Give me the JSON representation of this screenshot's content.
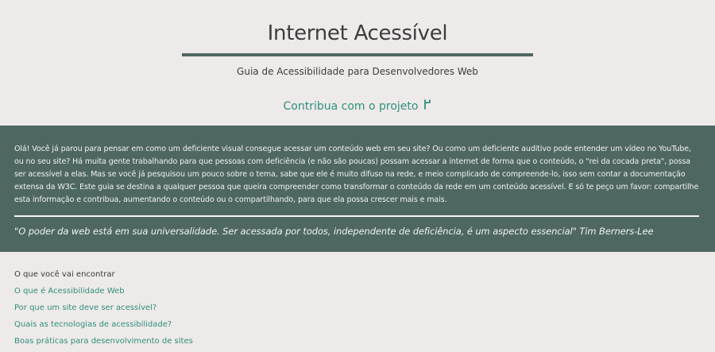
{
  "header": {
    "title": "Internet Acessível",
    "subtitle": "Guia de Acessibilidade para Desenvolvedores Web",
    "contribute_label": "Contribua com o projeto",
    "contribute_icon": "git-fork-icon"
  },
  "intro": {
    "text": "Olá! Você já parou para pensar em como um deficiente visual consegue acessar um conteúdo web em seu site? Ou como um deficiente auditivo pode entender um vídeo no YouTube, ou no seu site? Há muita gente trabalhando para que pessoas com deficiência (e não são poucas) possam acessar a internet de forma que o conteúdo, o \"rei da cocada preta\", possa ser acessível a elas. Mas se você já pesquisou um pouco sobre o tema, sabe que ele é muito difuso na rede, e meio complicado de compreende-lo, isso sem contar a documentação extensa da W3C. Este guia se destina a qualquer pessoa que queira compreender como transformar o conteúdo da rede em um conteúdo acessível. E só te peço um favor: compartilhe esta informação e contribua, aumentando o conteúdo ou o compartilhando, para que ela possa crescer mais e mais.",
    "quote": "\"O poder da web está em sua universalidade. Ser acessada por todos, independente de deficiência, é um aspecto essencial\" Tim Berners-Lee"
  },
  "toc": {
    "title": "O que você vai encontrar",
    "items": [
      "O que é Acessibilidade Web",
      "Por que um site deve ser acessível?",
      "Quais as tecnologias de acessibilidade?",
      "Boas práticas para desenvolvimento de sites"
    ]
  },
  "colors": {
    "background": "#eeeae9",
    "band": "#4f6762",
    "accent": "#2e8f7d"
  }
}
